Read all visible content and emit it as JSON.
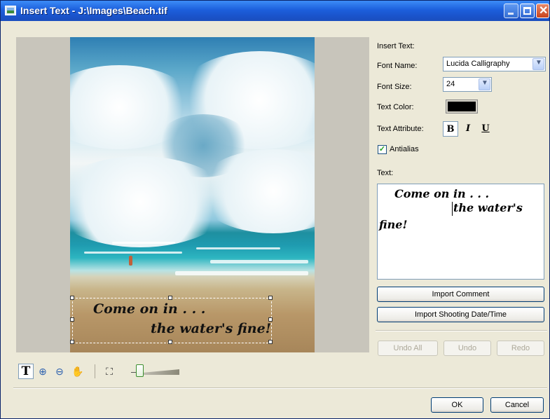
{
  "window": {
    "title": "Insert Text - J:\\Images\\Beach.tif"
  },
  "photo": {
    "overlay_line1": "Come on in . . .",
    "overlay_line2": "the water's fine!"
  },
  "panel": {
    "section_title": "Insert Text:",
    "font_name_label": "Font Name:",
    "font_name_value": "Lucida Calligraphy",
    "font_size_label": "Font Size:",
    "font_size_value": "24",
    "text_color_label": "Text Color:",
    "text_color_value": "#000000",
    "text_attribute_label": "Text Attribute:",
    "bold": "B",
    "italic": "I",
    "underline": "U",
    "antialias_label": "Antialias",
    "antialias_checked": true,
    "text_label": "Text:",
    "text_line1": "Come on in . . .",
    "text_line2": "the water's",
    "text_line3": "fine!",
    "import_comment": "Import Comment",
    "import_date": "Import Shooting Date/Time",
    "undo_all": "Undo All",
    "undo": "Undo",
    "redo": "Redo"
  },
  "toolbar": {
    "tools": [
      "text-tool",
      "zoom-in-tool",
      "zoom-out-tool",
      "hand-tool",
      "fit-tool"
    ],
    "zoom_level_fraction": 0.1
  },
  "footer": {
    "ok": "OK",
    "cancel": "Cancel"
  }
}
